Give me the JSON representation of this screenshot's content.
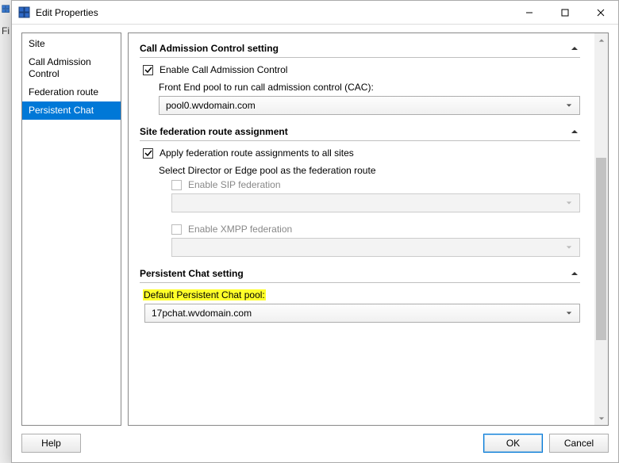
{
  "leftStrip": {
    "fi": "Fi"
  },
  "window": {
    "title": "Edit Properties",
    "controls": {
      "minimize": "minimize",
      "maximize": "maximize",
      "close": "close"
    }
  },
  "sidebar": {
    "items": [
      {
        "label": "Site"
      },
      {
        "label": "Call Admission Control"
      },
      {
        "label": "Federation route"
      },
      {
        "label": "Persistent Chat",
        "selected": true
      }
    ]
  },
  "sections": {
    "cac": {
      "title": "Call Admission Control setting",
      "enableLabel": "Enable Call Admission Control",
      "poolCaption": "Front End pool to run call admission control (CAC):",
      "poolValue": "pool0.wvdomain.com"
    },
    "fed": {
      "title": "Site federation route assignment",
      "applyLabel": "Apply federation route assignments to all sites",
      "selectCaption": "Select Director or Edge pool as the federation route",
      "sipLabel": "Enable SIP federation",
      "sipValue": "",
      "xmppLabel": "Enable XMPP federation",
      "xmppValue": ""
    },
    "pchat": {
      "title": "Persistent Chat setting",
      "poolCaption": "Default Persistent Chat pool:",
      "poolValue": "17pchat.wvdomain.com"
    }
  },
  "buttons": {
    "help": "Help",
    "ok": "OK",
    "cancel": "Cancel"
  }
}
